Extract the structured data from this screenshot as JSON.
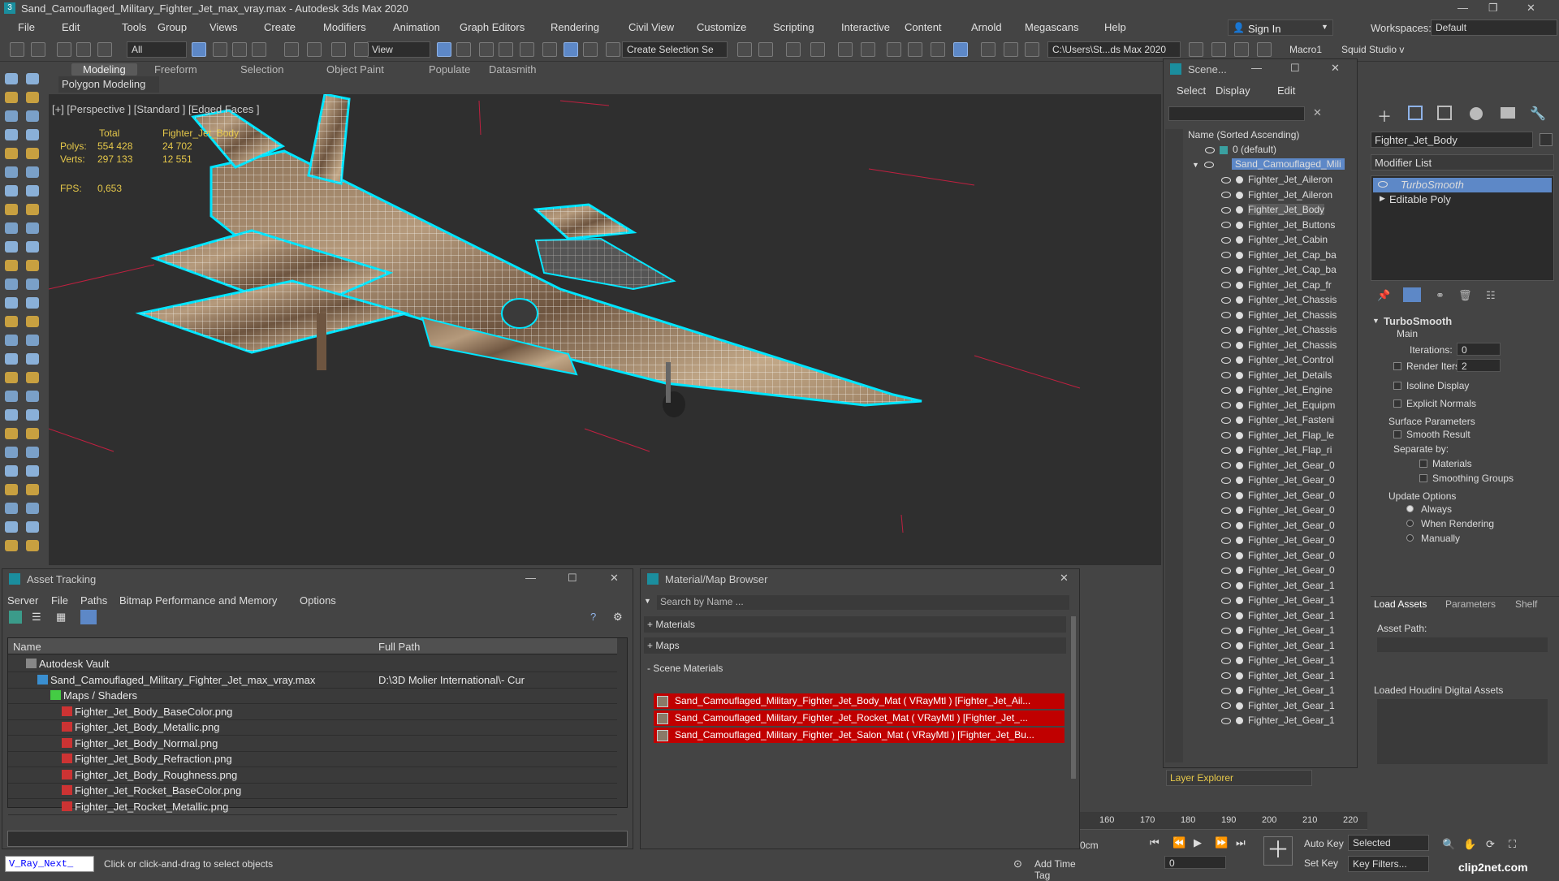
{
  "title": "Sand_Camouflaged_Military_Fighter_Jet_max_vray.max - Autodesk 3ds Max 2020",
  "menu": [
    "File",
    "Edit",
    "Tools",
    "Group",
    "Views",
    "Create",
    "Modifiers",
    "Animation",
    "Graph Editors",
    "Rendering",
    "Civil View",
    "Customize",
    "Scripting",
    "Interactive",
    "Content",
    "Arnold",
    "Megascans",
    "Help"
  ],
  "signin": "Sign In",
  "workspaces_label": "Workspaces:",
  "workspace_value": "Default",
  "toolbar": {
    "filter": "All",
    "view": "View",
    "selection_set": "Create Selection Se",
    "path": "C:\\Users\\St...ds Max 2020",
    "macro": "Macro1",
    "squid": "Squid Studio v"
  },
  "ribbon": [
    "Modeling",
    "Freeform",
    "Selection",
    "Object Paint",
    "Populate",
    "Datasmith"
  ],
  "ribbon_sub": "Polygon Modeling",
  "viewport": {
    "label": "[+] [Perspective ] [Standard ] [Edged Faces ]",
    "stats_total": "Total",
    "stats_obj": "Fighter_Jet_Body",
    "polys_label": "Polys:",
    "polys_total": "554 428",
    "polys_obj": "24 702",
    "verts_label": "Verts:",
    "verts_total": "297 133",
    "verts_obj": "12 551",
    "fps_label": "FPS:",
    "fps": "0,653"
  },
  "scene": {
    "title": "Scene...",
    "menu": [
      "Select",
      "Display",
      "Edit"
    ],
    "header": "Name (Sorted Ascending)",
    "root": "0 (default)",
    "object": "Sand_Camouflaged_Mili",
    "items": [
      "Fighter_Jet_Aileron",
      "Fighter_Jet_Aileron",
      "Fighter_Jet_Body",
      "Fighter_Jet_Buttons",
      "Fighter_Jet_Cabin",
      "Fighter_Jet_Cap_ba",
      "Fighter_Jet_Cap_ba",
      "Fighter_Jet_Cap_fr",
      "Fighter_Jet_Chassis",
      "Fighter_Jet_Chassis",
      "Fighter_Jet_Chassis",
      "Fighter_Jet_Chassis",
      "Fighter_Jet_Control",
      "Fighter_Jet_Details",
      "Fighter_Jet_Engine",
      "Fighter_Jet_Equipm",
      "Fighter_Jet_Fasteni",
      "Fighter_Jet_Flap_le",
      "Fighter_Jet_Flap_ri",
      "Fighter_Jet_Gear_0",
      "Fighter_Jet_Gear_0",
      "Fighter_Jet_Gear_0",
      "Fighter_Jet_Gear_0",
      "Fighter_Jet_Gear_0",
      "Fighter_Jet_Gear_0",
      "Fighter_Jet_Gear_0",
      "Fighter_Jet_Gear_0",
      "Fighter_Jet_Gear_1",
      "Fighter_Jet_Gear_1",
      "Fighter_Jet_Gear_1",
      "Fighter_Jet_Gear_1",
      "Fighter_Jet_Gear_1",
      "Fighter_Jet_Gear_1",
      "Fighter_Jet_Gear_1",
      "Fighter_Jet_Gear_1",
      "Fighter_Jet_Gear_1",
      "Fighter_Jet_Gear_1"
    ],
    "footer": "Layer Explorer"
  },
  "cmd": {
    "object_name": "Fighter_Jet_Body",
    "modifier_list": "Modifier List",
    "stack": [
      "TurboSmooth",
      "Editable Poly"
    ],
    "rollout": "TurboSmooth",
    "main": "Main",
    "iterations_label": "Iterations:",
    "iterations": "0",
    "render_iters_label": "Render Iters:",
    "render_iters": "2",
    "isoline": "Isoline Display",
    "explicit": "Explicit Normals",
    "surface": "Surface Parameters",
    "smooth_result": "Smooth Result",
    "separate_by": "Separate by:",
    "materials": "Materials",
    "smoothing": "Smoothing Groups",
    "update": "Update Options",
    "always": "Always",
    "when_rendering": "When Rendering",
    "manually": "Manually",
    "tabs": [
      "Load Assets",
      "Parameters",
      "Shelf"
    ],
    "asset_path": "Asset Path:",
    "loaded": "Loaded Houdini Digital Assets"
  },
  "asset": {
    "title": "Asset Tracking",
    "menu": [
      "Server",
      "File",
      "Paths",
      "Bitmap Performance and Memory",
      "Options"
    ],
    "col_name": "Name",
    "col_path": "Full Path",
    "vault": "Autodesk Vault",
    "file": "Sand_Camouflaged_Military_Fighter_Jet_max_vray.max",
    "file_path": "D:\\3D Molier International\\- Cur",
    "maps": "Maps / Shaders",
    "textures": [
      "Fighter_Jet_Body_BaseColor.png",
      "Fighter_Jet_Body_Metallic.png",
      "Fighter_Jet_Body_Normal.png",
      "Fighter_Jet_Body_Refraction.png",
      "Fighter_Jet_Body_Roughness.png",
      "Fighter_Jet_Rocket_BaseColor.png",
      "Fighter_Jet_Rocket_Metallic.png"
    ]
  },
  "matbrowser": {
    "title": "Material/Map Browser",
    "search": "Search by Name ...",
    "materials": "+ Materials",
    "maps": "+ Maps",
    "scene_materials": "- Scene Materials",
    "rows": [
      "Sand_Camouflaged_Military_Fighter_Jet_Body_Mat ( VRayMtl ) [Fighter_Jet_Ail...",
      "Sand_Camouflaged_Military_Fighter_Jet_Rocket_Mat ( VRayMtl ) [Fighter_Jet_...",
      "Sand_Camouflaged_Military_Fighter_Jet_Salon_Mat ( VRayMtl ) [Fighter_Jet_Bu..."
    ]
  },
  "timeline": {
    "ticks": [
      "160",
      "170",
      "180",
      "190",
      "200",
      "210",
      "220"
    ],
    "auto_key": "Auto Key",
    "set_key": "Set Key",
    "selected": "Selected",
    "key_filters": "Key Filters...",
    "frame": "0",
    "cm": "0cm"
  },
  "status": {
    "script": "V_Ray_Next_",
    "hint": "Click or click-and-drag to select objects",
    "add_time_tag": "Add Time Tag"
  },
  "watermark": "clip2net.com",
  "colors": {
    "wire": "#00e5ff",
    "accent": "#5d88c7",
    "stats": "#e6c84a",
    "mat": "#c00000"
  }
}
